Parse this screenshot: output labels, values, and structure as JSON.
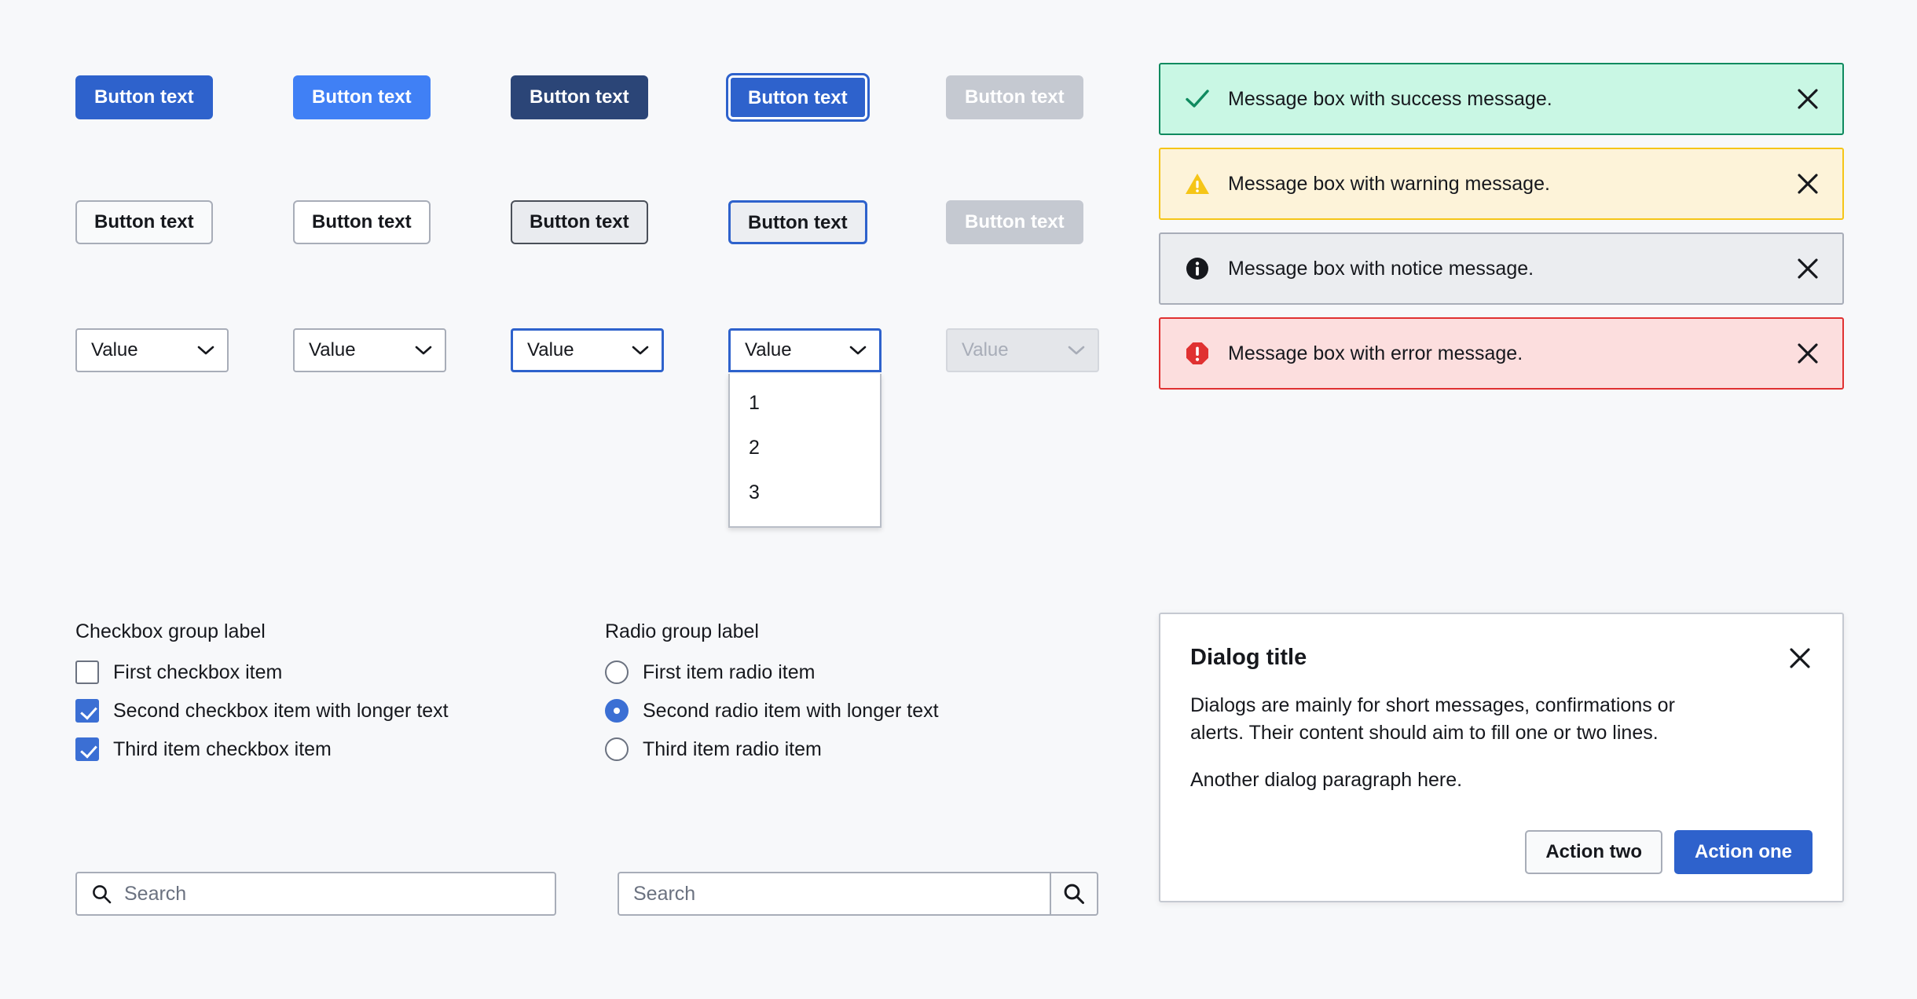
{
  "buttons": {
    "primary_row": [
      {
        "label": "Button text",
        "state": "default",
        "variant": "primary"
      },
      {
        "label": "Button text",
        "state": "hover",
        "variant": "primary"
      },
      {
        "label": "Button text",
        "state": "active",
        "variant": "primary"
      },
      {
        "label": "Button text",
        "state": "focus",
        "variant": "primary"
      },
      {
        "label": "Button text",
        "state": "disabled",
        "variant": "primary"
      }
    ],
    "secondary_row": [
      {
        "label": "Button text",
        "state": "default",
        "variant": "secondary"
      },
      {
        "label": "Button text",
        "state": "hover",
        "variant": "secondary"
      },
      {
        "label": "Button text",
        "state": "active",
        "variant": "secondary"
      },
      {
        "label": "Button text",
        "state": "focus",
        "variant": "secondary"
      },
      {
        "label": "Button text",
        "state": "disabled",
        "variant": "secondary"
      }
    ]
  },
  "selects": [
    {
      "value": "Value",
      "state": "default",
      "open": false
    },
    {
      "value": "Value",
      "state": "hover",
      "open": false
    },
    {
      "value": "Value",
      "state": "focus",
      "open": false
    },
    {
      "value": "Value",
      "state": "open",
      "open": true
    },
    {
      "value": "Value",
      "state": "disabled",
      "open": false
    }
  ],
  "select_options": [
    "1",
    "2",
    "3"
  ],
  "checkbox_group": {
    "label": "Checkbox group label",
    "items": [
      {
        "label": "First checkbox item",
        "checked": false
      },
      {
        "label": "Second checkbox item with longer text",
        "checked": true
      },
      {
        "label": "Third item checkbox item",
        "checked": true
      }
    ]
  },
  "radio_group": {
    "label": "Radio group label",
    "items": [
      {
        "label": "First item radio item",
        "checked": false
      },
      {
        "label": "Second radio item with longer text",
        "checked": true
      },
      {
        "label": "Third item radio item",
        "checked": false
      }
    ]
  },
  "search_inline": {
    "placeholder": "Search",
    "value": "",
    "icon": "search-icon"
  },
  "search_button": {
    "placeholder": "Search",
    "value": "",
    "icon": "search-icon"
  },
  "message_boxes": [
    {
      "type": "success",
      "icon": "check-icon",
      "text": "Message box with success message.",
      "close_icon": "close-icon",
      "bg": "#c9f7e4",
      "border": "#0f8a5f",
      "icon_color": "#0f8a5f"
    },
    {
      "type": "warning",
      "icon": "warning-triangle-icon",
      "text": "Message box with warning message.",
      "close_icon": "close-icon",
      "bg": "#fdf3d9",
      "border": "#f5c518",
      "icon_color": "#f5c518"
    },
    {
      "type": "notice",
      "icon": "info-circle-icon",
      "text": "Message box with notice message.",
      "close_icon": "close-icon",
      "bg": "#ebedf0",
      "border": "#a8adb8",
      "icon_color": "#16181d"
    },
    {
      "type": "error",
      "icon": "error-octagon-icon",
      "text": "Message box with error message.",
      "close_icon": "close-icon",
      "bg": "#fcdede",
      "border": "#e03131",
      "icon_color": "#e03131"
    }
  ],
  "dialog": {
    "title": "Dialog title",
    "close_icon": "close-icon",
    "paragraph_1": "Dialogs are mainly for short messages, confirmations or alerts. Their content should aim to fill one or two lines.",
    "paragraph_2": "Another dialog paragraph here.",
    "action_secondary": "Action two",
    "action_primary": "Action one"
  },
  "theme": {
    "page_background": "#f7f8fa",
    "primary": "#2e62cc",
    "primary_hover": "#4080f5",
    "primary_active": "#2b4577",
    "disabled": "#c5c9d1",
    "text": "#16181d",
    "border": "#a8adb8"
  }
}
